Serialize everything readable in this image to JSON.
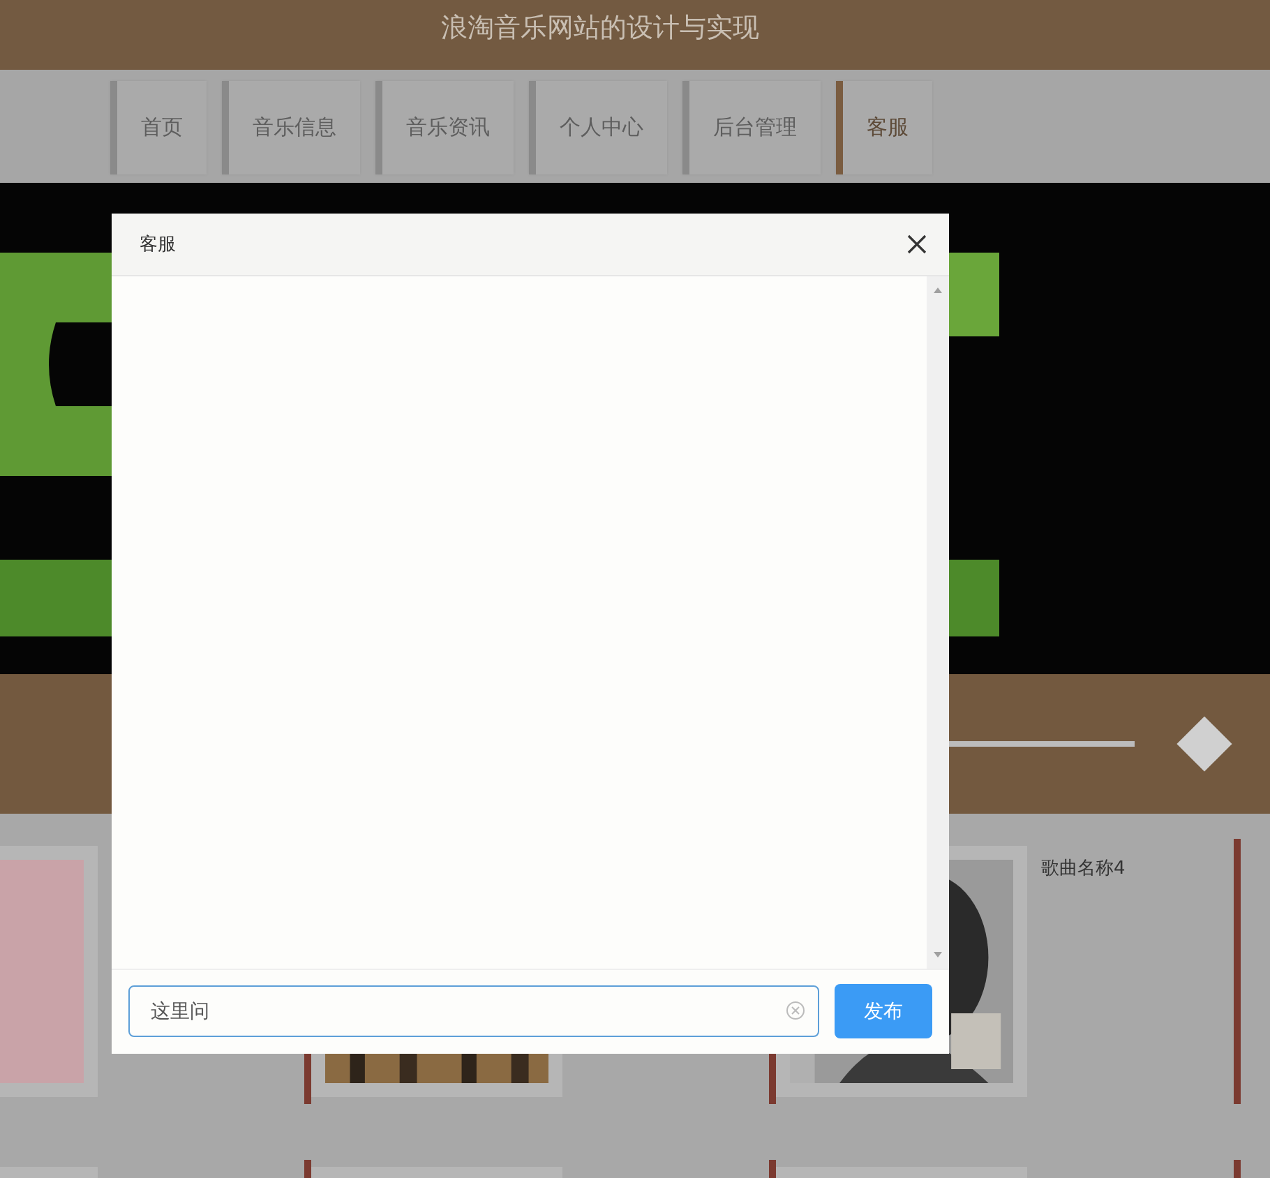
{
  "header": {
    "title": "浪淘音乐网站的设计与实现"
  },
  "nav": [
    {
      "label": "首页",
      "selected": false
    },
    {
      "label": "音乐信息",
      "selected": false
    },
    {
      "label": "音乐资讯",
      "selected": false
    },
    {
      "label": "个人中心",
      "selected": false
    },
    {
      "label": "后台管理",
      "selected": false
    },
    {
      "label": "客服",
      "selected": true
    }
  ],
  "banner": {
    "kind": "picture"
  },
  "song_rows": [
    [
      {
        "kind": "picture"
      },
      {
        "kind": "picture"
      },
      {
        "kind": "picture",
        "title": "歌曲名称4"
      }
    ],
    [
      {
        "kind": "blank"
      },
      {
        "kind": "blank"
      },
      {
        "kind": "blank"
      }
    ]
  ],
  "dialog": {
    "title": "客服",
    "input": {
      "value": "这里问"
    },
    "submit": "发布"
  }
}
